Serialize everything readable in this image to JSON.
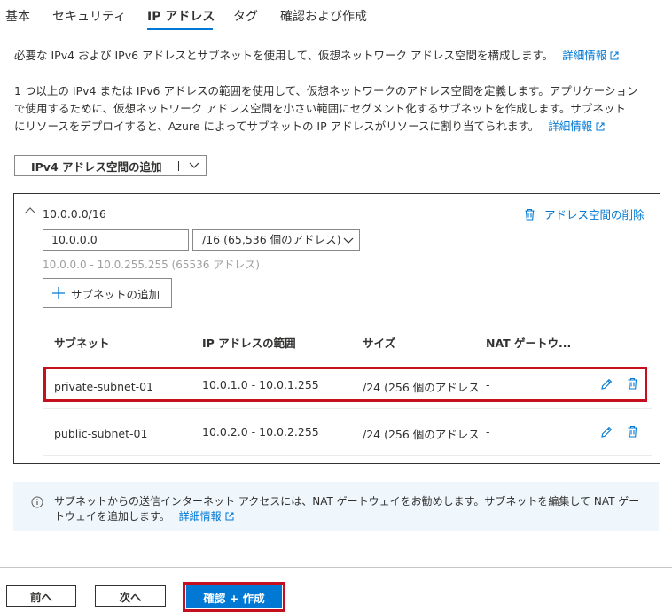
{
  "tabs": [
    {
      "label": "基本"
    },
    {
      "label": "セキュリティ"
    },
    {
      "label": "IP アドレス"
    },
    {
      "label": "タグ"
    },
    {
      "label": "確認および作成"
    }
  ],
  "intro": {
    "text": "必要な IPv4 および IPv6 アドレスとサブネットを使用して、仮想ネットワーク アドレス空間を構成します。",
    "link": "詳細情報"
  },
  "description": {
    "line1": "1 つ以上の IPv4 または IPv6 アドレスの範囲を使用して、仮想ネットワークのアドレス空間を定義します。アプリケーション",
    "line2": "で使用するために、仮想ネットワーク アドレス空間を小さい範囲にセグメント化するサブネットを作成します。サブネット",
    "line3": "にリソースをデプロイすると、Azure によってサブネットの IP アドレスがリソースに割り当てられます。",
    "link": "詳細情報"
  },
  "add_space_button": {
    "label": "IPv4 アドレス空間の追加"
  },
  "address_space": {
    "title": "10.0.0.0/16",
    "delete_label": "アドレス空間の削除",
    "address_value": "10.0.0.0",
    "prefix_value": "/16 (65,536 個のアドレス)",
    "range_hint": "10.0.0.0 - 10.0.255.255 (65536 アドレス)",
    "add_subnet_label": "サブネットの追加"
  },
  "table": {
    "headers": [
      "サブネット",
      "IP アドレスの範囲",
      "サイズ",
      "NAT ゲートウ..."
    ],
    "rows": [
      {
        "name": "private-subnet-01",
        "range": "10.0.1.0 - 10.0.1.255",
        "size": "/24 (256 個のアドレス",
        "nat": "-"
      },
      {
        "name": "public-subnet-01",
        "range": "10.0.2.0 - 10.0.2.255",
        "size": "/24 (256 個のアドレス",
        "nat": "-"
      }
    ]
  },
  "info": {
    "line1": "サブネットからの送信インターネット アクセスには、NAT ゲートウェイをお勧めします。サブネットを編集して NAT ゲー",
    "line2": "トウェイを追加します。",
    "link": "詳細情報"
  },
  "footer": {
    "prev": "前へ",
    "next": "次へ",
    "primary": "確認 + 作成"
  },
  "colors": {
    "accent": "#0078d4",
    "highlight": "#c50f1f"
  }
}
